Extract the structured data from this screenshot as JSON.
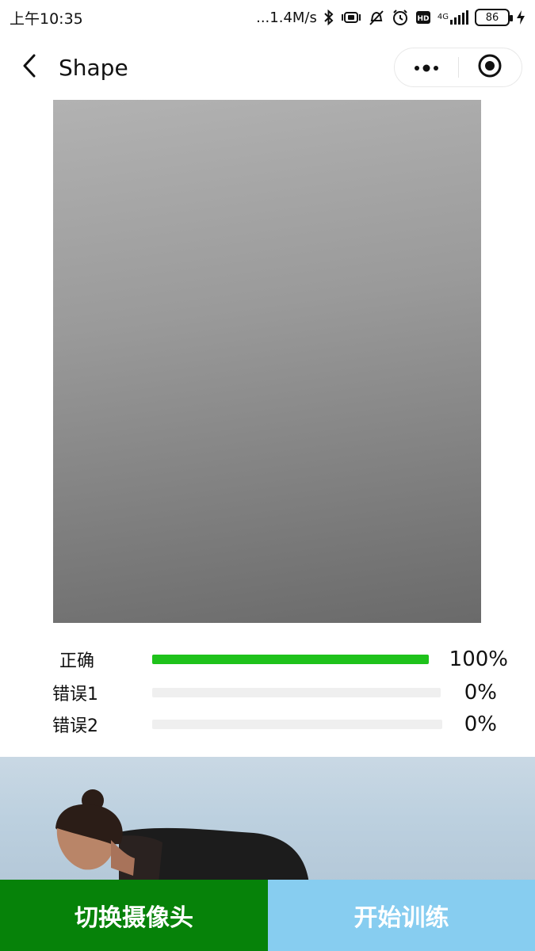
{
  "status_bar": {
    "time": "上午10:35",
    "network_speed": "...1.4M/s",
    "network_type": "4G",
    "battery": "86",
    "hd_badge": "HD"
  },
  "nav": {
    "title": "Shape",
    "back_icon": "chevron-left-icon",
    "more_icon": "more-dots-icon",
    "close_icon": "target-circle-icon"
  },
  "results": [
    {
      "label": "正确",
      "percent_text": "100%",
      "fraction": 1.0
    },
    {
      "label": "错误1",
      "percent_text": "0%",
      "fraction": 0.0
    },
    {
      "label": "错误2",
      "percent_text": "0%",
      "fraction": 0.0
    }
  ],
  "colors": {
    "progress_fill": "#1fc21b",
    "progress_track": "#efefef",
    "switch_button": "#068209",
    "start_button": "#87cdf0"
  },
  "buttons": {
    "switch_camera": "切换摄像头",
    "start_training": "开始训练"
  }
}
